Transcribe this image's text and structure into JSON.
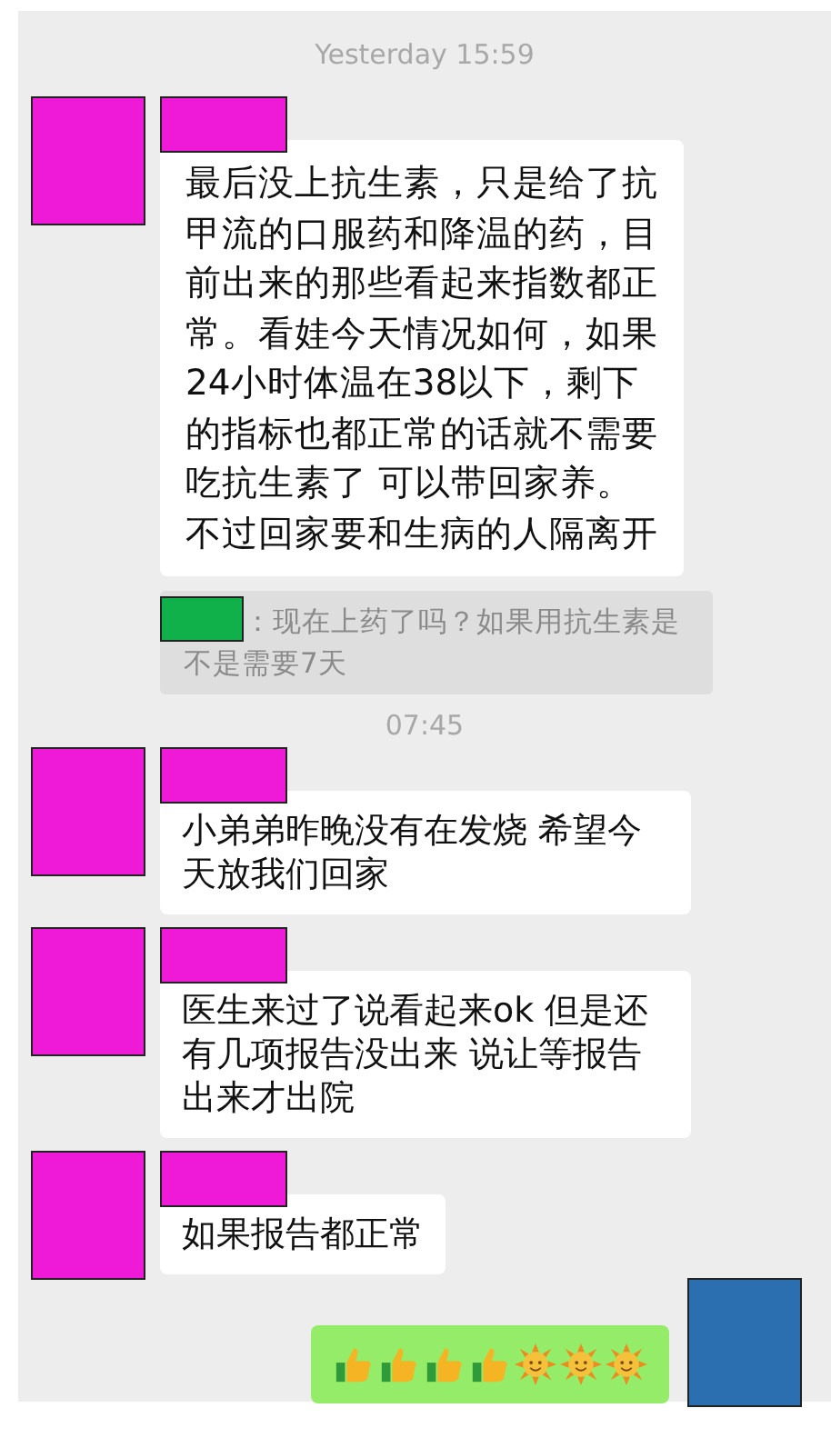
{
  "chat": [
    {
      "kind": "time",
      "text": "Yesterday 15:59"
    },
    {
      "kind": "incoming",
      "avatar": {
        "color": "#ee1ad8"
      },
      "name_mask": {
        "color": "#ee1ad8"
      },
      "text": "最后没上抗生素，只是给了抗甲流的口服药和降温的药，目前出来的那些看起来指数都正常。看娃今天情况如何，如果24小时体温在38以下，剩下的指标也都正常的话就不需要吃抗生素了 可以带回家养。不过回家要和生病的人隔离开",
      "large": true,
      "quote": {
        "name_mask": {
          "color": "#10b04a"
        },
        "text": "：现在上药了吗？如果用抗生素是不是需要7天"
      }
    },
    {
      "kind": "time",
      "text": "07:45"
    },
    {
      "kind": "incoming",
      "avatar": {
        "color": "#ee1ad8"
      },
      "name_mask": {
        "color": "#ee1ad8"
      },
      "text": "小弟弟昨晚没有在发烧 希望今天放我们回家",
      "large": false
    },
    {
      "kind": "incoming",
      "avatar": {
        "color": "#ee1ad8"
      },
      "name_mask": {
        "color": "#ee1ad8"
      },
      "text": "医生来过了说看起来ok 但是还有几项报告没出来 说让等报告出来才出院",
      "large": false
    },
    {
      "kind": "incoming",
      "avatar": {
        "color": "#ee1ad8"
      },
      "name_mask": {
        "color": "#ee1ad8"
      },
      "text": "如果报告都正常",
      "large": false
    },
    {
      "kind": "outgoing",
      "avatar": {
        "color": "#2c6fb0"
      },
      "emoji": [
        {
          "kind": "thumbs"
        },
        {
          "kind": "thumbs"
        },
        {
          "kind": "thumbs"
        },
        {
          "kind": "thumbs"
        },
        {
          "kind": "sun"
        },
        {
          "kind": "sun"
        },
        {
          "kind": "sun"
        }
      ]
    }
  ]
}
